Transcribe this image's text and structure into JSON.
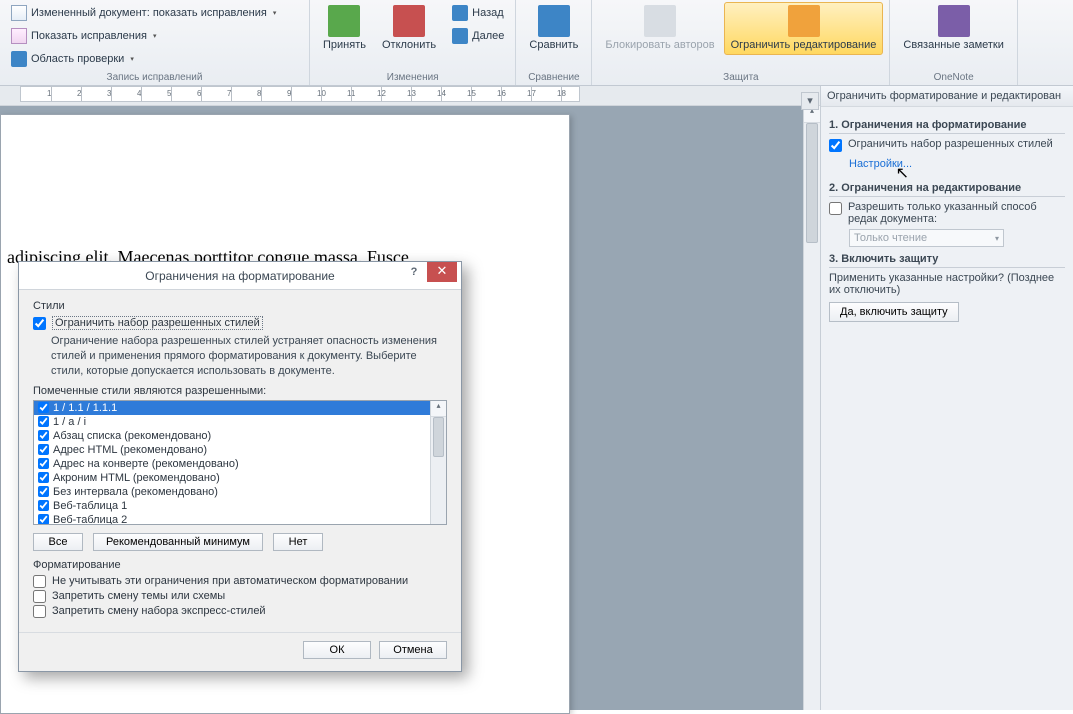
{
  "ribbon": {
    "groups": {
      "tracking": {
        "title": "Запись исправлений",
        "changed_doc": "Измененный документ: показать исправления",
        "show_changes": "Показать исправления",
        "review_pane": "Область проверки"
      },
      "changes": {
        "title": "Изменения",
        "accept": "Принять",
        "reject": "Отклонить",
        "back": "Назад",
        "forward": "Далее"
      },
      "compare": {
        "title": "Сравнение",
        "compare": "Сравнить"
      },
      "protect": {
        "title": "Защита",
        "block_authors": "Блокировать авторов",
        "restrict_editing": "Ограничить редактирование"
      },
      "onenote": {
        "title": "OneNote",
        "linked_notes": "Связанные заметки"
      }
    }
  },
  "document": {
    "visible_text": "adipiscing elit. Maecenas porttitor congue massa. Fusce"
  },
  "dialog": {
    "title": "Ограничения на форматирование",
    "styles_label": "Стили",
    "restrict_checkbox": "Ограничить набор разрешенных стилей",
    "description": "Ограничение набора разрешенных стилей устраняет опасность изменения стилей и применения прямого форматирования к документу. Выберите стили, которые допускается использовать в документе.",
    "list_label": "Помеченные стили являются разрешенными:",
    "styles": [
      "1 / 1.1 / 1.1.1",
      "1 / a / i",
      "Абзац списка (рекомендовано)",
      "Адрес HTML (рекомендовано)",
      "Адрес на конверте (рекомендовано)",
      "Акроним HTML (рекомендовано)",
      "Без интервала (рекомендовано)",
      "Веб-таблица 1",
      "Веб-таблица 2"
    ],
    "btn_all": "Все",
    "btn_min": "Рекомендованный минимум",
    "btn_none": "Нет",
    "format_label": "Форматирование",
    "opt_autoformat": "Не учитывать эти ограничения при автоматическом форматировании",
    "opt_theme": "Запретить смену темы или схемы",
    "opt_quickstyles": "Запретить смену набора экспресс-стилей",
    "ok": "ОК",
    "cancel": "Отмена"
  },
  "sidepanel": {
    "title": "Ограничить форматирование и редактирован",
    "h1": "1. Ограничения на форматирование",
    "cb1": "Ограничить набор разрешенных стилей",
    "link1": "Настройки...",
    "h2": "2. Ограничения на редактирование",
    "cb2": "Разрешить только указанный способ редак документа:",
    "select_value": "Только чтение",
    "h3": "3. Включить защиту",
    "note": "Применить указанные настройки? (Позднее их отключить)",
    "enable_btn": "Да, включить защиту"
  }
}
